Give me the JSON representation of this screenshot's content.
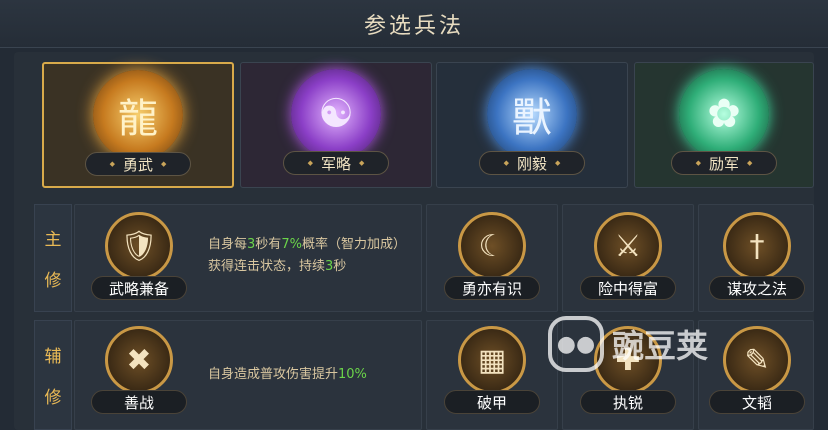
{
  "title": "参选兵法",
  "categories": [
    {
      "label": "勇武",
      "icon": "dragon-emblem-icon",
      "glyph": "龍",
      "color": "#e9a53e",
      "bg": "#3a3224",
      "selected": true
    },
    {
      "label": "军略",
      "icon": "yinyang-emblem-icon",
      "glyph": "☯",
      "color": "#a857d9",
      "bg": "#2d2735",
      "selected": false
    },
    {
      "label": "刚毅",
      "icon": "beast-emblem-icon",
      "glyph": "獸",
      "color": "#4f8ee0",
      "bg": "#252f3b",
      "selected": false
    },
    {
      "label": "励军",
      "icon": "gourd-emblem-icon",
      "glyph": "✿",
      "color": "#3ed39a",
      "bg": "#253530",
      "selected": false
    }
  ],
  "main": {
    "label_top": "主",
    "label_bottom": "修",
    "featured": {
      "name": "武略兼备",
      "icon": "scroll-shield-icon",
      "glyph": "🛡"
    },
    "desc": {
      "p1": "自身每",
      "v1": "3",
      "p2": "秒有",
      "v2": "7%",
      "p3": "概率（智力加成）获得连击状态，持续",
      "v3": "3",
      "p4": "秒"
    },
    "skills": [
      {
        "name": "勇亦有识",
        "icon": "crescent-star-icon",
        "glyph": "☾"
      },
      {
        "name": "险中得富",
        "icon": "swords-ring-icon",
        "glyph": "⚔"
      },
      {
        "name": "谋攻之法",
        "icon": "triple-swords-icon",
        "glyph": "†"
      }
    ]
  },
  "aux": {
    "label_top": "辅",
    "label_bottom": "修",
    "featured": {
      "name": "善战",
      "icon": "crossed-sabers-icon",
      "glyph": "✖"
    },
    "desc": {
      "p1": "自身造成普攻伤害提升",
      "v1": "10%"
    },
    "skills": [
      {
        "name": "破甲",
        "icon": "broken-armor-icon",
        "glyph": "▦"
      },
      {
        "name": "执锐",
        "icon": "sword-grip-icon",
        "glyph": "✚"
      },
      {
        "name": "文韬",
        "icon": "tome-icon",
        "glyph": "✎"
      }
    ]
  },
  "watermark": {
    "logo": "●●",
    "text": "豌豆荚"
  }
}
